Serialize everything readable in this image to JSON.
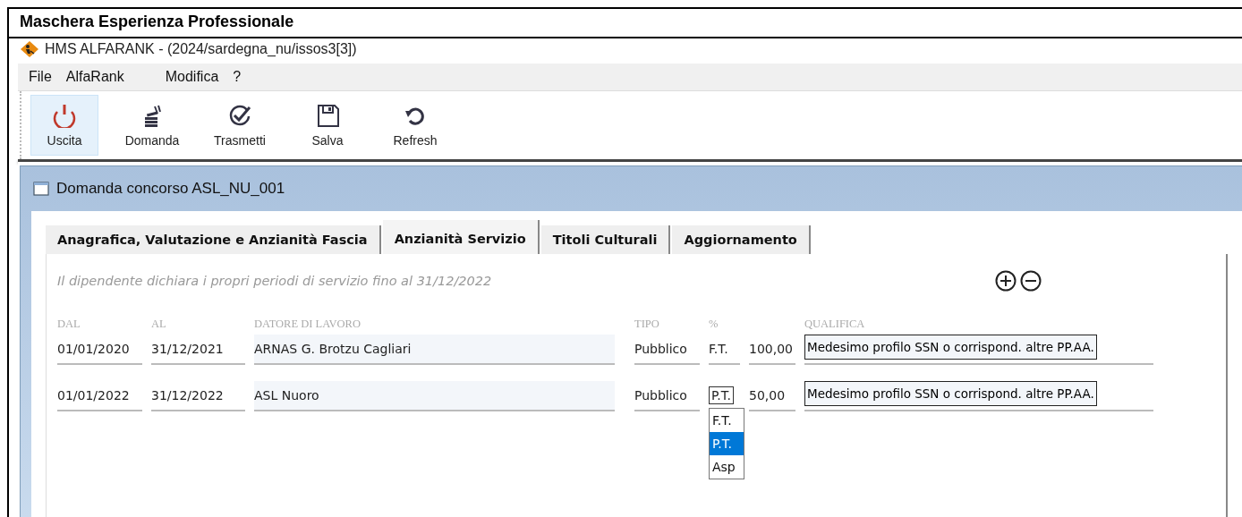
{
  "caption": "Maschera Esperienza Professionale",
  "app": {
    "title": "HMS ALFARANK - (2024/sardegna_nu/issos3[3])",
    "menu": [
      "File",
      "AlfaRank",
      "Modifica",
      "?"
    ],
    "toolbar": [
      {
        "label": "Uscita",
        "kind": "power",
        "selected": true
      },
      {
        "label": "Domanda",
        "kind": "stack",
        "selected": false
      },
      {
        "label": "Trasmetti",
        "kind": "check",
        "selected": false
      },
      {
        "label": "Salva",
        "kind": "save",
        "selected": false
      },
      {
        "label": "Refresh",
        "kind": "refresh",
        "selected": false
      }
    ]
  },
  "window": {
    "title": "Domanda concorso ASL_NU_001",
    "tabs": [
      {
        "label": "Anagrafica, Valutazione e Anzianità Fascia",
        "selected": false
      },
      {
        "label": "Anzianità Servizio",
        "selected": true
      },
      {
        "label": "Titoli Culturali",
        "selected": false
      },
      {
        "label": "Aggiornamento",
        "selected": false
      }
    ],
    "note": "Il dipendente dichiara i propri periodi di servizio fino al 31/12/2022",
    "columns": [
      "DAL",
      "AL",
      "DATORE DI LAVORO",
      "TIPO",
      "%",
      "QUALIFICA"
    ],
    "rows": [
      {
        "dal": "01/01/2020",
        "al": "31/12/2021",
        "datore": "ARNAS G. Brotzu Cagliari",
        "tipo": "Pubblico",
        "regime": "F.T.",
        "regime_open": false,
        "percentuale": "100,00",
        "qualifica": "Medesimo profilo SSN o corrispond. altre PP.AA."
      },
      {
        "dal": "01/01/2022",
        "al": "31/12/2022",
        "datore": "ASL Nuoro",
        "tipo": "Pubblico",
        "regime": "P.T.",
        "regime_open": true,
        "regime_options": [
          {
            "label": "F.T.",
            "selected": false
          },
          {
            "label": "P.T.",
            "selected": true
          },
          {
            "label": "Asp",
            "selected": false
          }
        ],
        "percentuale": "50,00",
        "qualifica": "Medesimo profilo SSN o corrispond. altre PP.AA."
      }
    ]
  }
}
